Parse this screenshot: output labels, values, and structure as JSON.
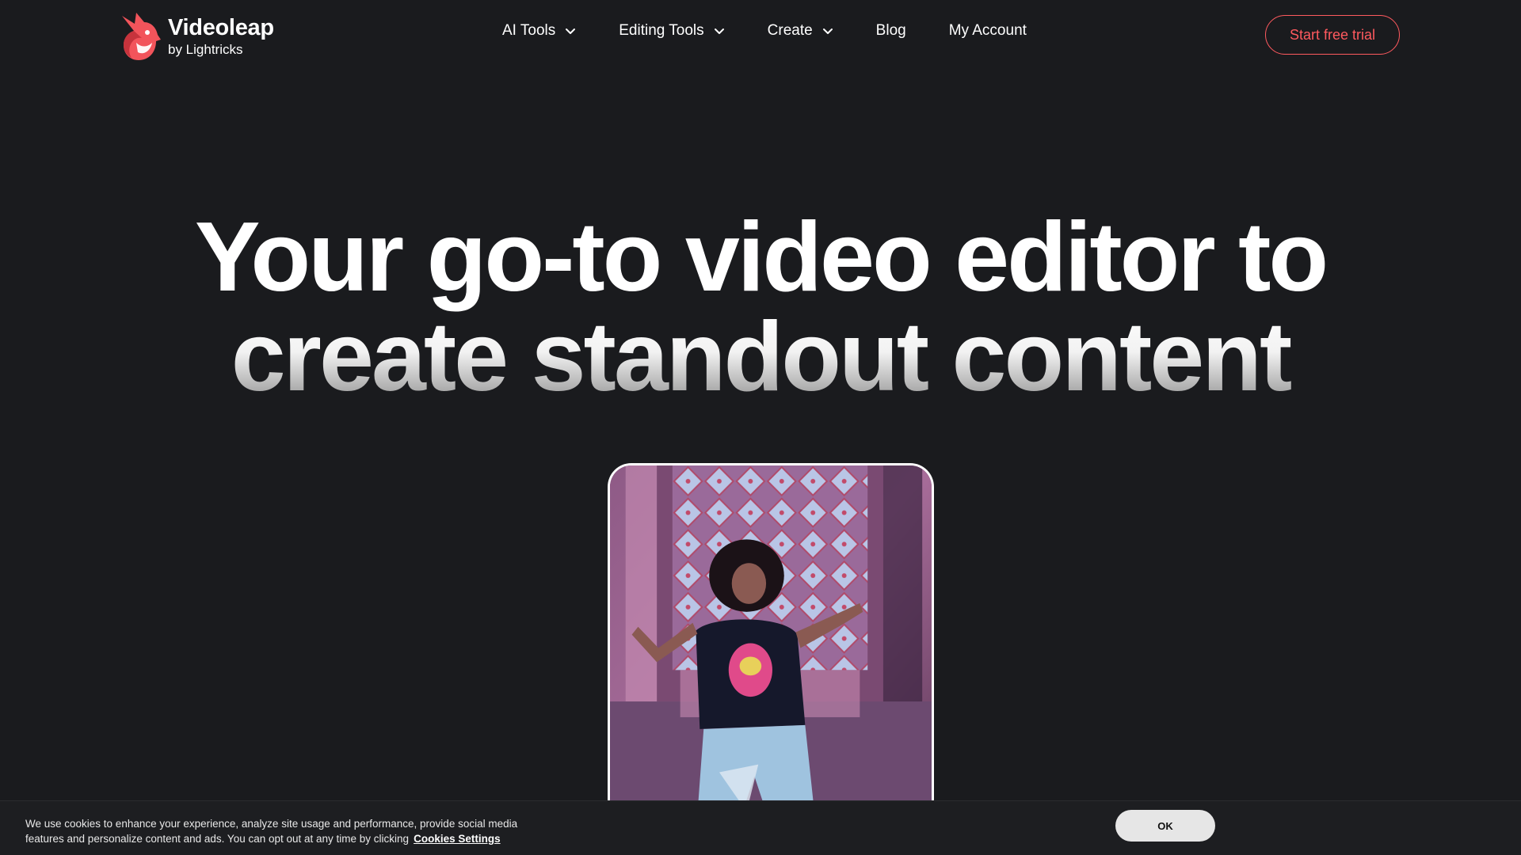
{
  "brand": {
    "name": "Videoleap",
    "sub": "by Lightricks",
    "accent_color": "#ff5a5f"
  },
  "nav": {
    "items": [
      {
        "label": "AI Tools",
        "icon": "chevron-down-icon"
      },
      {
        "label": "Editing Tools",
        "icon": "chevron-down-icon"
      },
      {
        "label": "Create",
        "icon": "chevron-down-icon"
      },
      {
        "label": "Blog"
      },
      {
        "label": "My Account"
      }
    ]
  },
  "header": {
    "cta_label": "Start free trial"
  },
  "hero": {
    "title_line1": "Your go-to video editor to",
    "title_line2": "create standout content"
  },
  "cookie": {
    "text_line1": "We use cookies to enhance your experience, analyze site usage and performance, provide social media",
    "text_line2": "features and personalize content and ads. You can opt out at any time by clicking",
    "link_label": "Cookies Settings",
    "ok_label": "OK"
  }
}
